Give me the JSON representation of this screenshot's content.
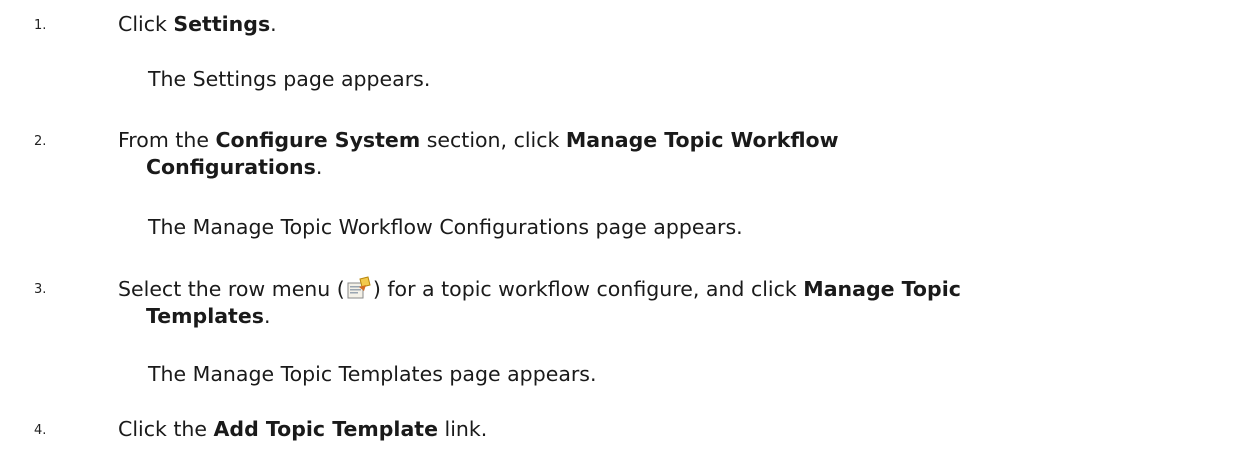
{
  "steps": [
    {
      "number": "1.",
      "before": "Click ",
      "bold1": "Settings",
      "after": ".",
      "result": "The Settings page appears."
    },
    {
      "number": "2.",
      "before": "From the ",
      "bold1": "Configure System",
      "middle": " section, click ",
      "bold2_line1": "Manage Topic Workflow",
      "bold2_line2": "Configurations",
      "after": ".",
      "result": "The Manage Topic Workflow Configurations page appears."
    },
    {
      "number": "3.",
      "before": "Select the row menu (",
      "icon": "row-menu-icon",
      "middle": ") for a topic workflow configure, and click ",
      "bold_line1": "Manage Topic",
      "bold_line2": "Templates",
      "after": ".",
      "result": "The Manage Topic Templates page appears."
    },
    {
      "number": "4.",
      "before": "Click the ",
      "bold1": "Add Topic Template",
      "after": " link."
    }
  ]
}
